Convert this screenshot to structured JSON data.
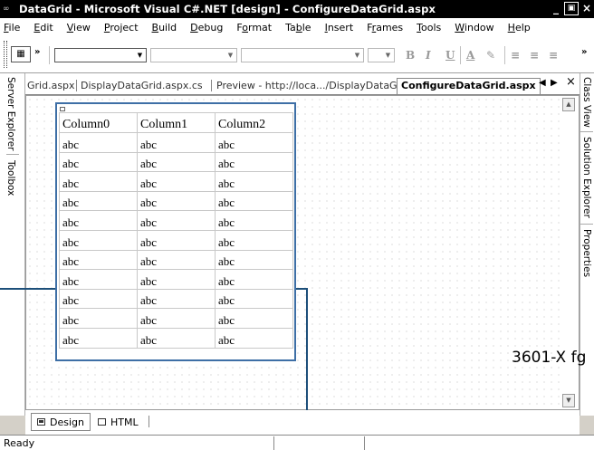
{
  "window": {
    "title": "DataGrid - Microsoft Visual C#.NET [design] - ConfigureDataGrid.aspx",
    "app_icon": "vs-app-icon",
    "controls": [
      "_",
      "Ő",
      "×"
    ]
  },
  "menu": [
    {
      "label": "File",
      "accel": "F",
      "rest": "ile"
    },
    {
      "label": "Edit",
      "accel": "E",
      "rest": "dit"
    },
    {
      "label": "View",
      "accel": "V",
      "rest": "iew"
    },
    {
      "label": "Project",
      "accel": "P",
      "rest": "roject"
    },
    {
      "label": "Build",
      "accel": "B",
      "rest": "uild"
    },
    {
      "label": "Debug",
      "accel": "D",
      "rest": "ebug"
    },
    {
      "label": "Format",
      "pre": "F",
      "accel": "o",
      "rest": "rmat"
    },
    {
      "label": "Table",
      "pre": "Ta",
      "accel": "b",
      "rest": "le"
    },
    {
      "label": "Insert",
      "accel": "I",
      "rest": "nsert"
    },
    {
      "label": "Frames",
      "pre": "F",
      "accel": "r",
      "rest": "ames"
    },
    {
      "label": "Tools",
      "accel": "T",
      "rest": "ools"
    },
    {
      "label": "Window",
      "accel": "W",
      "rest": "indow"
    },
    {
      "label": "Help",
      "accel": "H",
      "rest": "elp"
    }
  ],
  "toolbar": {
    "chevron_left": "»",
    "chevron_right": "»",
    "bold": "B",
    "italic": "I",
    "underline": "U",
    "font_color": "A"
  },
  "left_panel": {
    "tabs": [
      "Server Explorer",
      "Toolbox"
    ]
  },
  "right_panel": {
    "tabs": [
      "Class View",
      "Solution Explorer",
      "Properties"
    ]
  },
  "doc_tabs": {
    "items": [
      "Grid.aspx",
      "DisplayDataGrid.aspx.cs",
      "Preview - http://loca.../DisplayDataGrid.aspx",
      "ConfigureDataGrid.aspx"
    ],
    "active_index": 3,
    "nav_prev": "◀",
    "nav_next": "▶",
    "close": "×"
  },
  "datagrid": {
    "headers": [
      "Column0",
      "Column1",
      "Column2"
    ],
    "rows": [
      [
        "abc",
        "abc",
        "abc"
      ],
      [
        "abc",
        "abc",
        "abc"
      ],
      [
        "abc",
        "abc",
        "abc"
      ],
      [
        "abc",
        "abc",
        "abc"
      ],
      [
        "abc",
        "abc",
        "abc"
      ],
      [
        "abc",
        "abc",
        "abc"
      ],
      [
        "abc",
        "abc",
        "abc"
      ],
      [
        "abc",
        "abc",
        "abc"
      ],
      [
        "abc",
        "abc",
        "abc"
      ],
      [
        "abc",
        "abc",
        "abc"
      ],
      [
        "abc",
        "abc",
        "abc"
      ]
    ]
  },
  "figure_id": "3601-X fg",
  "view_tabs": {
    "design": "Design",
    "html": "HTML"
  },
  "status": {
    "text": "Ready"
  },
  "colors": {
    "selection_border": "#3e6fa6",
    "callout_line": "#1d4f7a"
  }
}
